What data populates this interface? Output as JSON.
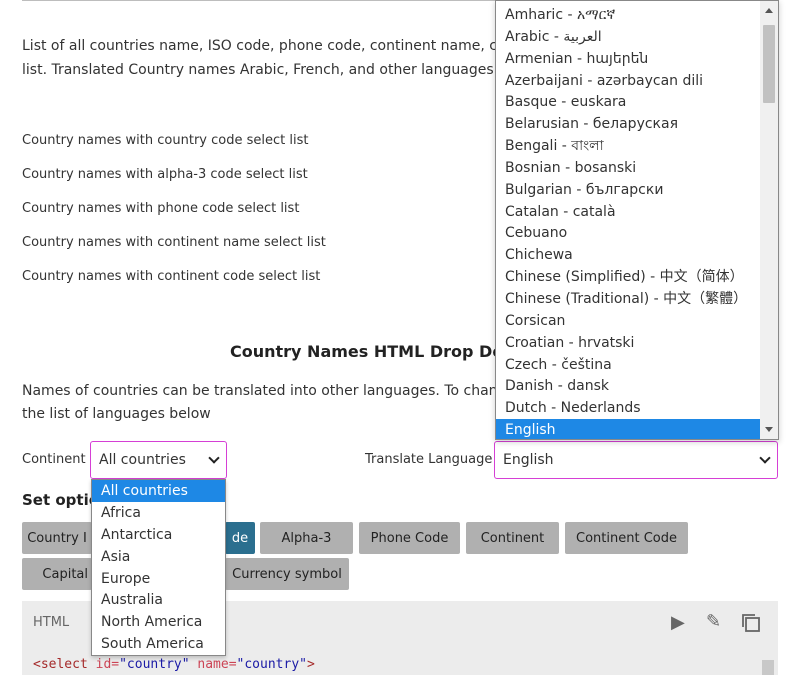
{
  "intro": {
    "line1": "List of all countries name, ISO code, phone code, continent name, cap",
    "line2": "list. Translated Country names Arabic, French, and other languages."
  },
  "links": [
    "Country names with country code select list",
    "Country names with alpha-3 code select list",
    "Country names with phone code select list",
    "Country names with continent name select list",
    "Country names with continent code select list"
  ],
  "section": {
    "heading": "Country Names HTML Drop Dov",
    "para_line1": "Names of countries can be translated into other languages. To chang",
    "para_line2": "the list of languages below"
  },
  "continent": {
    "label": "Continent",
    "selected": "All countries",
    "options": [
      "All countries",
      "Africa",
      "Antarctica",
      "Asia",
      "Europe",
      "Australia",
      "North America",
      "South America"
    ]
  },
  "translate": {
    "label": "Translate Language",
    "selected": "English",
    "options": [
      "Amharic - አማርኛ",
      "Arabic - العربية",
      "Armenian - հայերեն",
      "Azerbaijani - azərbaycan dili",
      "Basque - euskara",
      "Belarusian - беларуская",
      "Bengali - বাংলা",
      "Bosnian - bosanski",
      "Bulgarian - български",
      "Catalan - català",
      "Cebuano",
      "Chichewa",
      "Chinese (Simplified) - 中文（简体）",
      "Chinese (Traditional) - 中文（繁體）",
      "Corsican",
      "Croatian - hrvatski",
      "Czech - čeština",
      "Danish - dansk",
      "Dutch - Nederlands",
      "English"
    ]
  },
  "options": {
    "label": "Set optio",
    "buttons_row1": [
      "Country I",
      "de",
      "Alpha-3",
      "Phone Code",
      "Continent",
      "Continent Code"
    ],
    "buttons_row2": [
      "Capital",
      "Currency symbol"
    ]
  },
  "code": {
    "lang": "HTML",
    "line_tag_open": "<select ",
    "attr1": "id=",
    "val1": "\"country\"",
    "attr2": " name=",
    "val2": "\"country\"",
    "tag_close": ">"
  }
}
